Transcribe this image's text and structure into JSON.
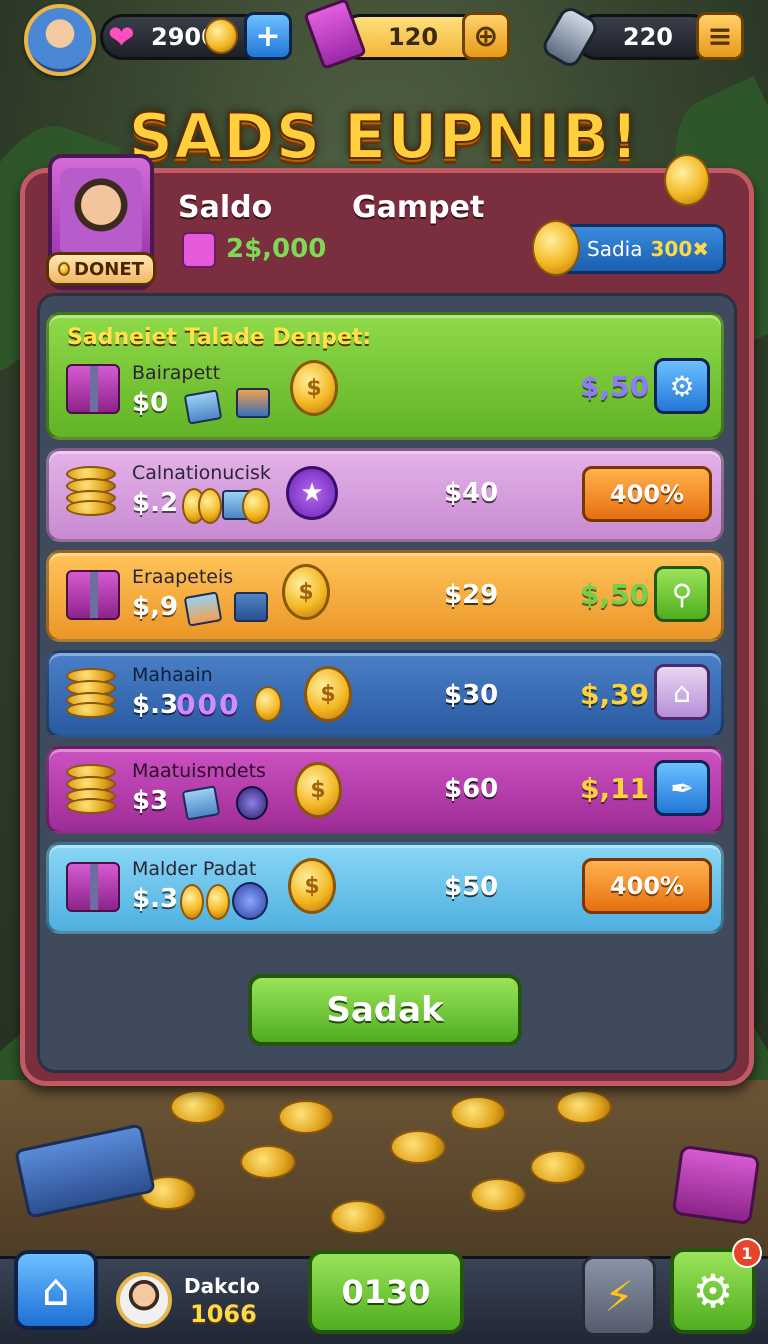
{
  "top_bar": {
    "gems_value": "2900",
    "plus_label": "+",
    "tickets_value": "120",
    "tickets_btn": "⊕",
    "energy_value": "220",
    "menu_label": "≡"
  },
  "title": "SADS EUPNIB!",
  "header": {
    "profile_tag": "DONET",
    "col1_label": "Saldo",
    "col2_label": "Gampet",
    "balance": "2$,000",
    "sadia_label": "Sadia",
    "sadia_amount": "300✖"
  },
  "offers": {
    "heading": "Sadneiet Talade Denpet:",
    "rows": [
      {
        "name": "Bairapett",
        "cost": "$0",
        "price": "",
        "reward": "$,50",
        "button": "⚙"
      },
      {
        "name": "Calnationucisk",
        "cost": "$.2",
        "price": "$40",
        "reward": "",
        "button": "400%"
      },
      {
        "name": "Eraapeteis",
        "cost": "$,9",
        "price": "$29",
        "reward": "$,50",
        "button": "⚲"
      },
      {
        "name": "Mahaain",
        "cost": "$.3",
        "price": "$30",
        "reward": "$,39",
        "button": "⌂",
        "tokens": "000"
      },
      {
        "name": "Maatuismdets",
        "cost": "$3",
        "price": "$60",
        "reward": "$,11",
        "button": "✒"
      },
      {
        "name": "Malder Padat",
        "cost": "$.3",
        "price": "$50",
        "reward": "",
        "button": "400%"
      }
    ]
  },
  "main_button": "Sadak",
  "bottom_bar": {
    "home_icon": "⌂",
    "user_name": "Dakclo",
    "user_score": "1066",
    "center_button": "0130",
    "bolt_icon": "⚡",
    "gear_icon": "⚙",
    "badge_count": "1"
  },
  "colors": {
    "panel": "#7a2e3e",
    "row_green": "#7ec93a",
    "row_pink": "#d99be0",
    "row_orange": "#f2a93b",
    "row_blue": "#3e6fb8",
    "row_magenta": "#b93fb0",
    "row_sky": "#6cc4ec"
  }
}
